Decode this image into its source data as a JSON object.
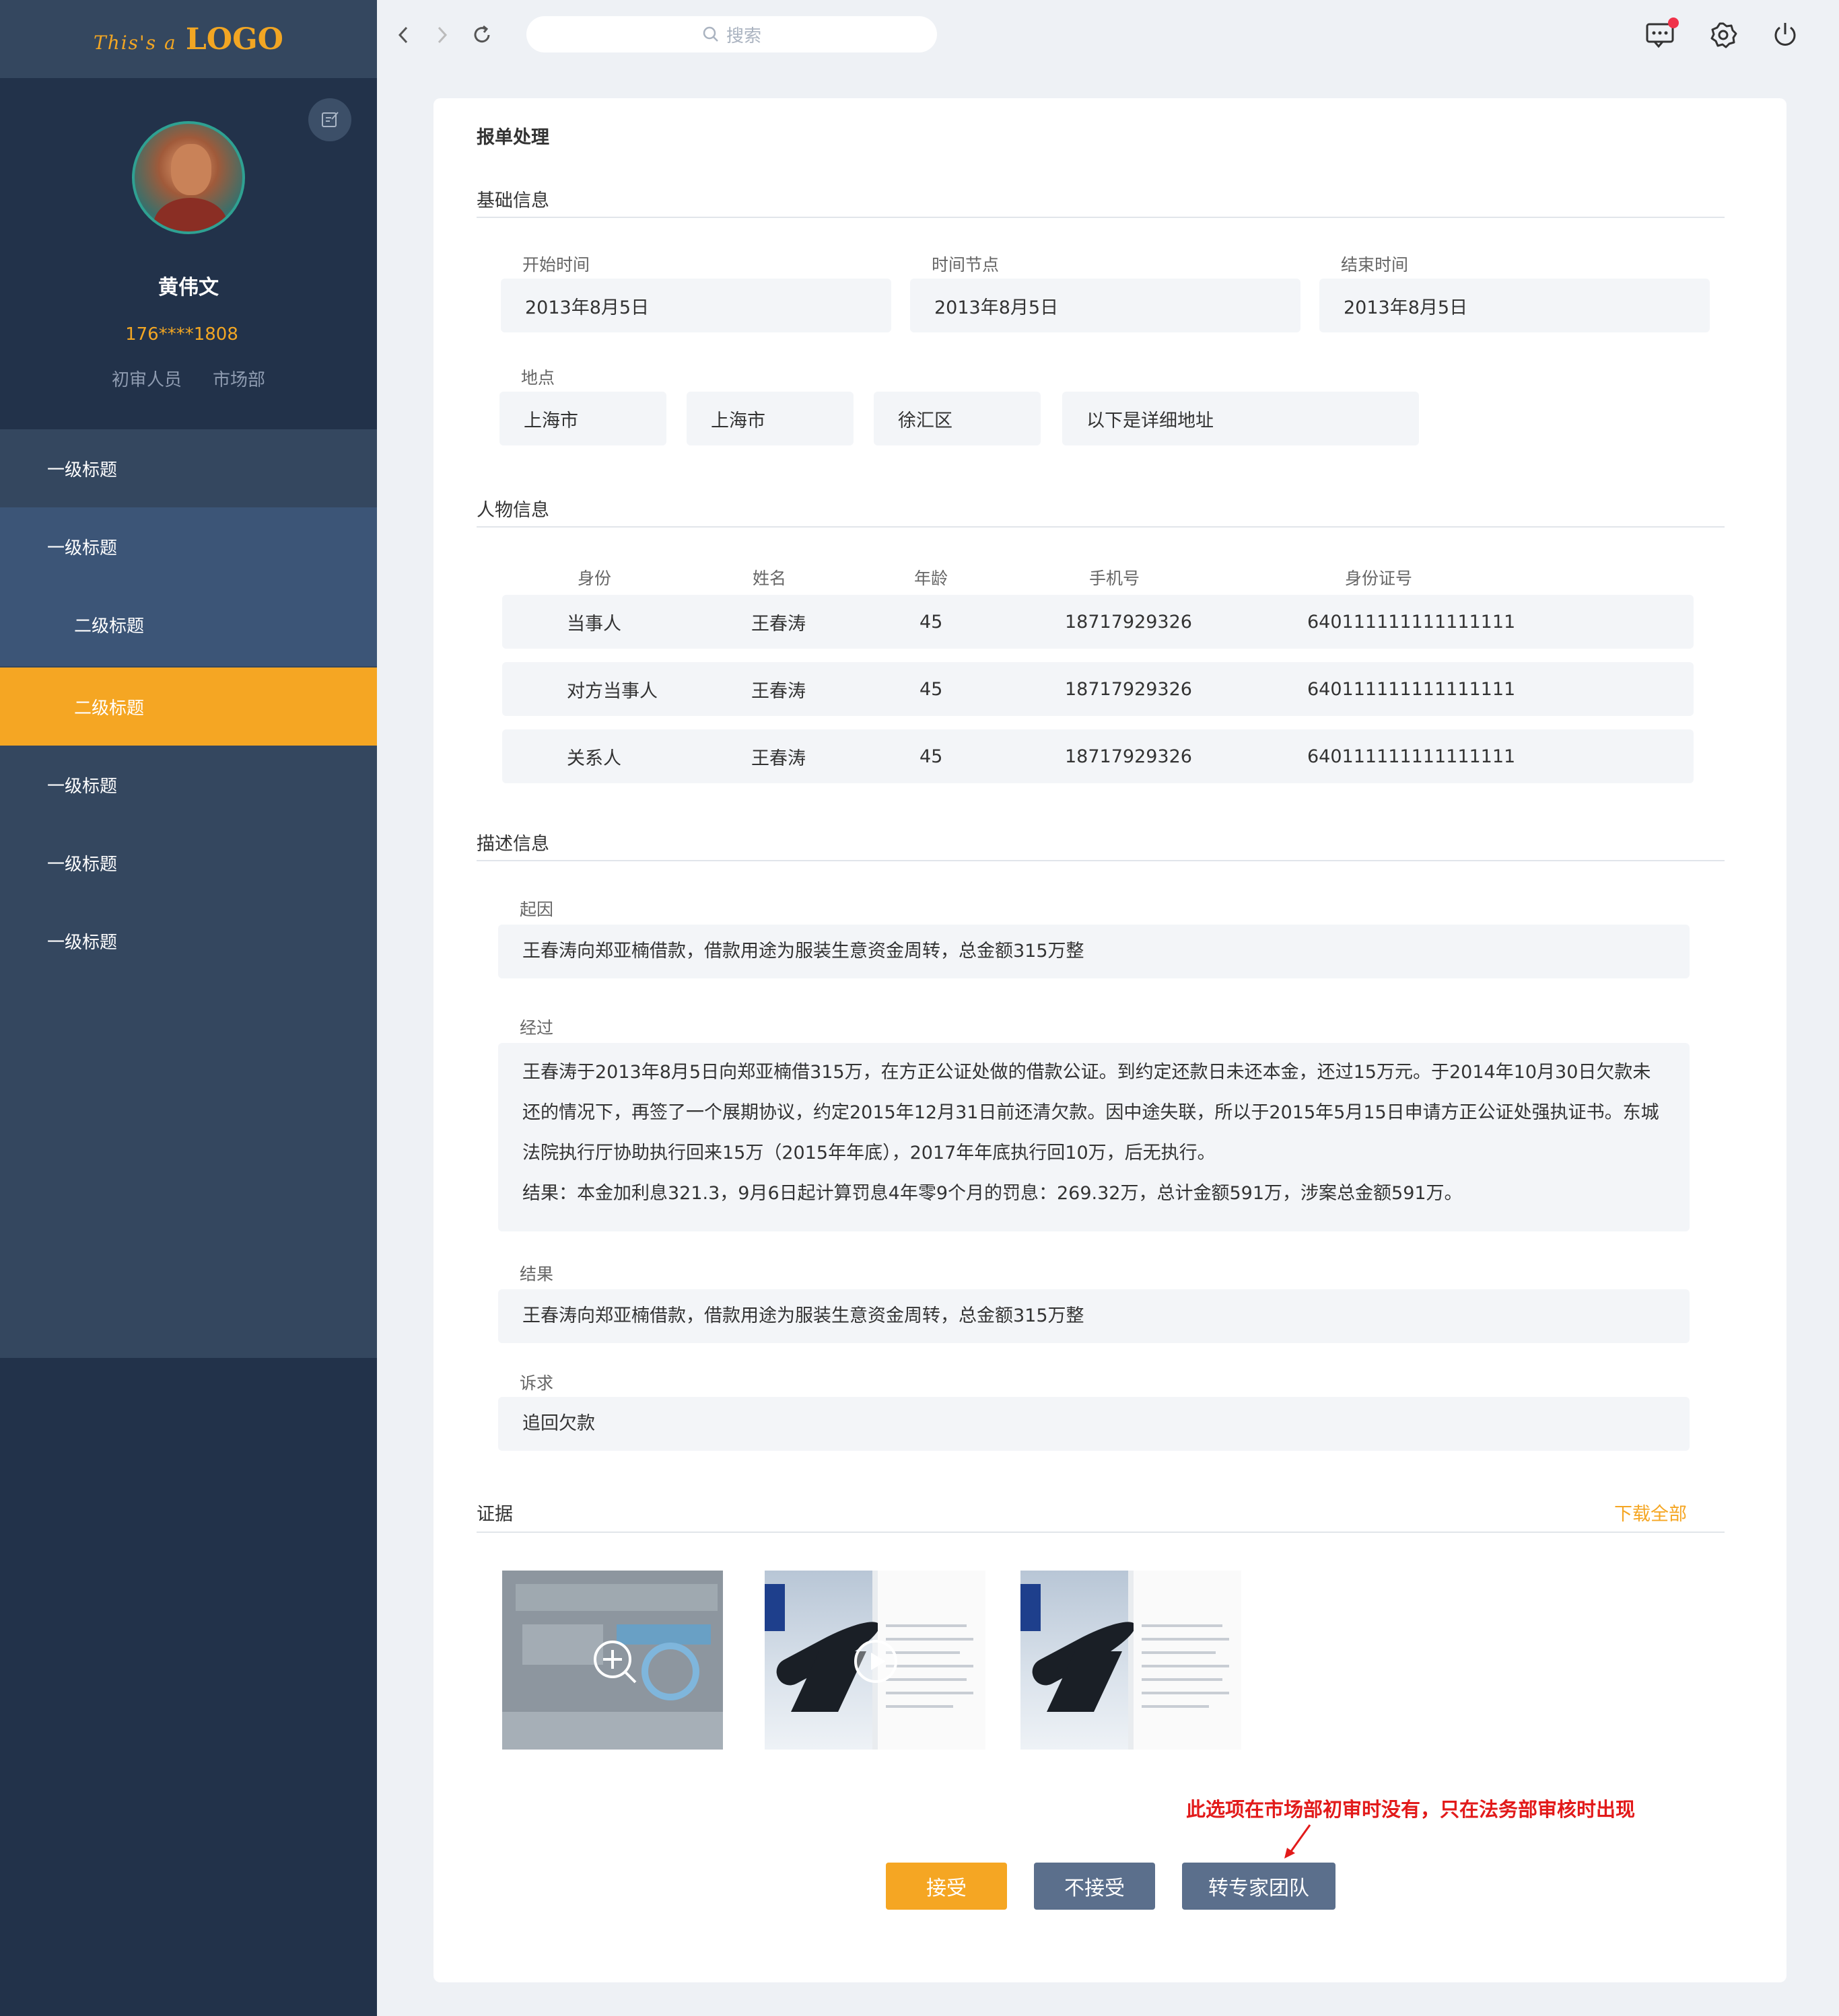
{
  "sidebar": {
    "logo_small": "This's a",
    "logo_big": "LOGO",
    "user_name": "黄伟文",
    "user_phone": "176****1808",
    "user_role": "初审人员",
    "user_dept": "市场部",
    "menu": [
      {
        "label": "一级标题",
        "level": 1
      },
      {
        "label": "一级标题",
        "level": 1
      },
      {
        "label": "二级标题",
        "level": 2
      },
      {
        "label": "二级标题",
        "level": 2,
        "active": true
      },
      {
        "label": "一级标题",
        "level": 1
      },
      {
        "label": "一级标题",
        "level": 1
      },
      {
        "label": "一级标题",
        "level": 1
      }
    ]
  },
  "topbar": {
    "search_placeholder": "搜索"
  },
  "page": {
    "title": "报单处理",
    "basic": {
      "heading": "基础信息",
      "start_label": "开始时间",
      "start_value": "2013年8月5日",
      "node_label": "时间节点",
      "node_value": "2013年8月5日",
      "end_label": "结束时间",
      "end_value": "2013年8月5日",
      "location_label": "地点",
      "location_province": "上海市",
      "location_city": "上海市",
      "location_district": "徐汇区",
      "location_detail": "以下是详细地址"
    },
    "people": {
      "heading": "人物信息",
      "columns": [
        "身份",
        "姓名",
        "年龄",
        "手机号",
        "身份证号"
      ],
      "rows": [
        [
          "当事人",
          "王春涛",
          "45",
          "18717929326",
          "640111111111111111"
        ],
        [
          "对方当事人",
          "王春涛",
          "45",
          "18717929326",
          "640111111111111111"
        ],
        [
          "关系人",
          "王春涛",
          "45",
          "18717929326",
          "640111111111111111"
        ]
      ]
    },
    "description": {
      "heading": "描述信息",
      "cause_label": "起因",
      "cause_text": "王春涛向郑亚楠借款，借款用途为服装生意资金周转，总金额315万整",
      "process_label": "经过",
      "process_text": "王春涛于2013年8月5日向郑亚楠借315万，在方正公证处做的借款公证。到约定还款日未还本金，还过15万元。于2014年10月30日欠款未还的情况下，再签了一个展期协议，约定2015年12月31日前还清欠款。因中途失联，所以于2015年5月15日申请方正公证处强执证书。东城法院执行厅协助执行回来15万（2015年年底），2017年年底执行回10万，后无执行。",
      "process_result": "结果：本金加利息321.3，9月6日起计算罚息4年零9个月的罚息：269.32万，总计金额591万，涉案总金额591万。",
      "result_label": "结果",
      "result_text": "王春涛向郑亚楠借款，借款用途为服装生意资金周转，总金额315万整",
      "claim_label": "诉求",
      "claim_text": "追回欠款"
    },
    "evidence": {
      "heading": "证据",
      "download_all": "下载全部"
    },
    "hint": "此选项在市场部初审时没有，只在法务部审核时出现",
    "actions": {
      "accept": "接受",
      "reject": "不接受",
      "transfer": "转专家团队"
    }
  },
  "colors": {
    "accent": "#f5a623",
    "sidebar_bg": "#22324a",
    "menu_bg": "#34475f",
    "hint": "#e21a1a"
  }
}
